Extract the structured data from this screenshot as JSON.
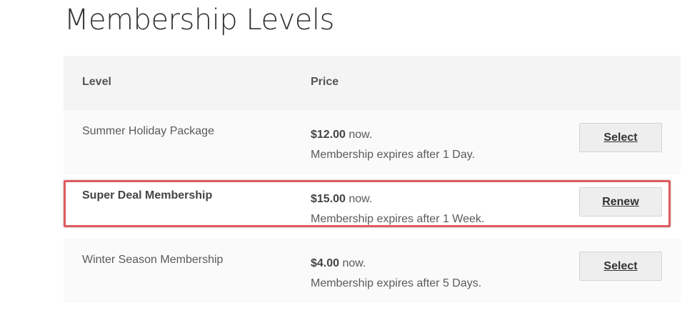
{
  "page": {
    "title": "Membership Levels"
  },
  "table": {
    "headers": {
      "level": "Level",
      "price": "Price"
    },
    "rows": [
      {
        "level": "Summer Holiday Package",
        "price": "$12.00",
        "price_suffix": " now.",
        "expires": "Membership expires after 1 Day.",
        "action": "Select"
      },
      {
        "level": "Super Deal Membership",
        "price": "$15.00",
        "price_suffix": " now.",
        "expires": "Membership expires after 1 Week.",
        "action": "Renew"
      },
      {
        "level": "Winter Season Membership",
        "price": "$4.00",
        "price_suffix": " now.",
        "expires": "Membership expires after 5 Days.",
        "action": "Select"
      }
    ]
  },
  "colors": {
    "highlight_border": "#e05a5f",
    "button_bg": "#eeeeee",
    "header_bg": "#f4f4f4"
  }
}
